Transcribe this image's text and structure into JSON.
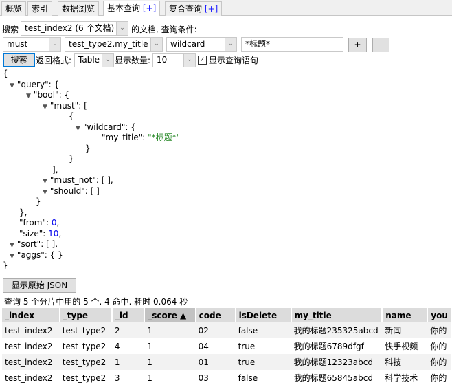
{
  "tabs": [
    {
      "label": "概览"
    },
    {
      "label": "索引"
    },
    {
      "label": "数据浏览"
    },
    {
      "label": "基本查询",
      "suffix": "[+]",
      "active": true
    },
    {
      "label": "复合查询",
      "suffix": "[+]"
    }
  ],
  "search_row": {
    "prefix_label": "搜索",
    "index_select": "test_index2 (6 个文档)",
    "suffix_label": "的文档,  查询条件:"
  },
  "condition_row": {
    "bool_select": "must",
    "field_select": "test_type2.my_title",
    "op_select": "wildcard",
    "value_input": "*标题*",
    "add_label": "+",
    "remove_label": "-"
  },
  "options_row": {
    "search_button": "搜索",
    "format_label": "返回格式:",
    "format_select": "Table",
    "count_label": "显示数量:",
    "count_select": "10",
    "show_query_checked": true,
    "show_query_label": "显示查询语句"
  },
  "json_view": {
    "lines": [
      {
        "indent": 0,
        "toggle": false,
        "key": "",
        "text": "{"
      },
      {
        "indent": 1,
        "toggle": true,
        "text": "\"query\": {"
      },
      {
        "indent": 2,
        "toggle": true,
        "text": "\"bool\": {"
      },
      {
        "indent": 3,
        "toggle": true,
        "text": "\"must\": ["
      },
      {
        "indent": 4,
        "toggle": false,
        "text": "{"
      },
      {
        "indent": 5,
        "toggle": true,
        "text": "\"wildcard\": {"
      },
      {
        "indent": 6,
        "toggle": false,
        "text": "\"my_title\": ",
        "value": "\"*标题*\"",
        "vtype": "str"
      },
      {
        "indent": 5,
        "toggle": false,
        "text": "}"
      },
      {
        "indent": 4,
        "toggle": false,
        "text": "}"
      },
      {
        "indent": 3,
        "toggle": false,
        "text": "],"
      },
      {
        "indent": 3,
        "toggle": true,
        "text": "\"must_not\": [ ],"
      },
      {
        "indent": 3,
        "toggle": true,
        "text": "\"should\": [ ]"
      },
      {
        "indent": 2,
        "toggle": false,
        "text": "}"
      },
      {
        "indent": 1,
        "toggle": false,
        "text": "},"
      },
      {
        "indent": 1,
        "toggle": false,
        "text": "\"from\": ",
        "value": "0",
        "vtype": "num",
        "tail": ","
      },
      {
        "indent": 1,
        "toggle": false,
        "text": "\"size\": ",
        "value": "10",
        "vtype": "num",
        "tail": ","
      },
      {
        "indent": 1,
        "toggle": true,
        "text": "\"sort\": [ ],"
      },
      {
        "indent": 1,
        "toggle": true,
        "text": "\"aggs\": { }"
      },
      {
        "indent": 0,
        "toggle": false,
        "text": "}"
      }
    ]
  },
  "raw_json_button": "显示原始 JSON",
  "results_info": "查询 5 个分片中用的 5 个. 4 命中. 耗时 0.064 秒",
  "table": {
    "columns": [
      "_index",
      "_type",
      "_id",
      "_score ▲",
      "code",
      "isDelete",
      "my_title",
      "name",
      "you"
    ],
    "sorted_column": 3,
    "rows": [
      [
        "test_index2",
        "test_type2",
        "2",
        "1",
        "02",
        "false",
        "我的标题235325abcd",
        "新闻",
        "你的"
      ],
      [
        "test_index2",
        "test_type2",
        "4",
        "1",
        "04",
        "true",
        "我的标题6789dfgf",
        "快手视频",
        "你的"
      ],
      [
        "test_index2",
        "test_type2",
        "1",
        "1",
        "01",
        "true",
        "我的标题12323abcd",
        "科技",
        "你的"
      ],
      [
        "test_index2",
        "test_type2",
        "3",
        "1",
        "03",
        "false",
        "我的标题65845abcd",
        "科学技术",
        "你的"
      ]
    ]
  }
}
